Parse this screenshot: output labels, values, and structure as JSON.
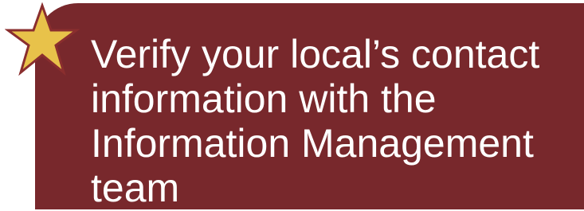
{
  "callout": {
    "text": "Verify your local’s contact\ninformation with the\nInformation Management\nteam"
  },
  "colors": {
    "card_background": "#78282c",
    "text": "#ffffff",
    "star_fill": "#e8c24a",
    "star_outline": "#8a2e2e"
  },
  "icons": {
    "badge": "star-icon"
  }
}
